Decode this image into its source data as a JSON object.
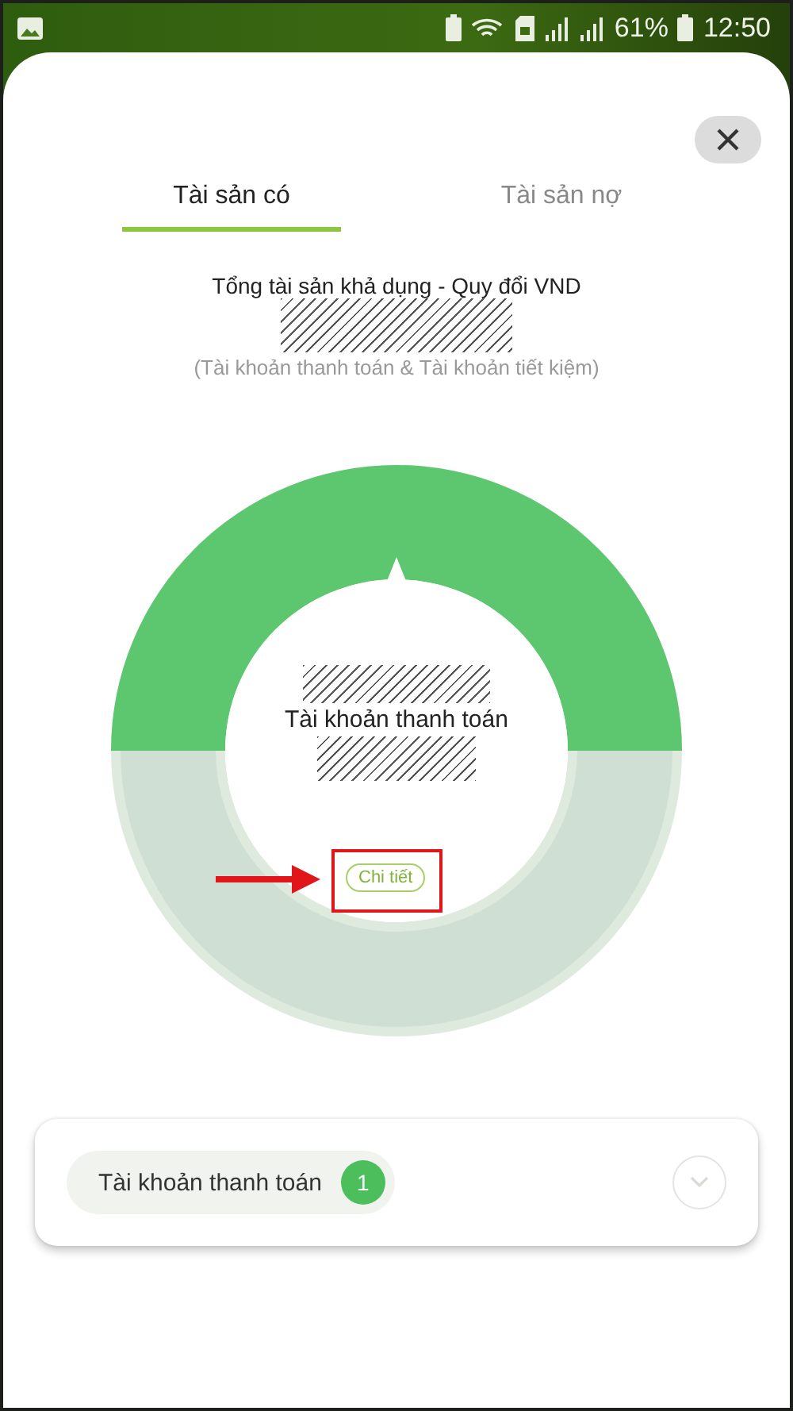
{
  "status_bar": {
    "battery": "61%",
    "time": "12:50"
  },
  "tabs": [
    {
      "label": "Tài sản có",
      "selected": true
    },
    {
      "label": "Tài sản nợ",
      "selected": false
    }
  ],
  "summary": {
    "title": "Tổng tài sản khả dụng - Quy đổi VND",
    "note": "(Tài khoản thanh toán & Tài khoản tiết kiệm)"
  },
  "donut": {
    "center_label": "Tài khoản thanh toán",
    "detail_button": "Chi tiết",
    "highlighted": true
  },
  "accounts": [
    {
      "label": "Tài khoản thanh toán",
      "count": "1"
    }
  ]
}
